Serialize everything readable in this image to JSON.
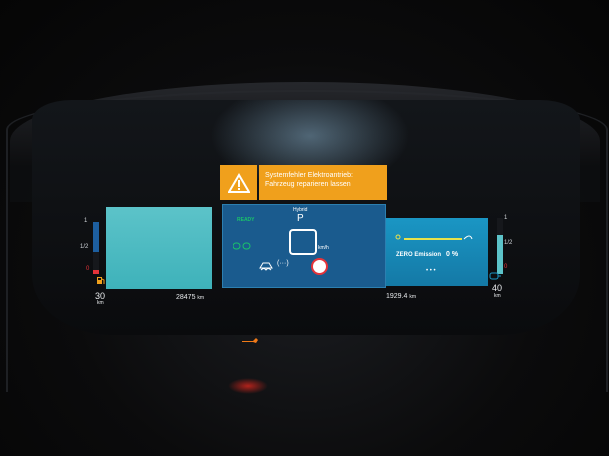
{
  "warning": {
    "icon": "warning-triangle-icon",
    "line1": "Systemfehler Elektroantrieb:",
    "line2": "Fahrzeug reparieren lassen"
  },
  "center": {
    "ready": "READY",
    "mode": "Hybrid",
    "gear": "P",
    "speed_unit": "km/h"
  },
  "left_gauge": {
    "top": "1",
    "half": "1/2",
    "bottom": "0",
    "range": "30",
    "unit": "km",
    "fuel_level": 0.08
  },
  "right_gauge": {
    "top": "1",
    "half": "1/2",
    "bottom": "0",
    "range": "40",
    "unit": "km",
    "charge_level": 0.7
  },
  "odometer": {
    "value": "28475",
    "unit": "km"
  },
  "trip": {
    "value": "1929.4",
    "unit": "km"
  },
  "right_panel": {
    "label": "ZERO Emission",
    "value": "0 %",
    "dots": "• • •"
  },
  "colors": {
    "warning": "#f0a01c",
    "ready": "#19c36a",
    "panel_left": "#4fbcc3",
    "panel_center": "#1a5b8e",
    "panel_right": "#1a96c4"
  }
}
